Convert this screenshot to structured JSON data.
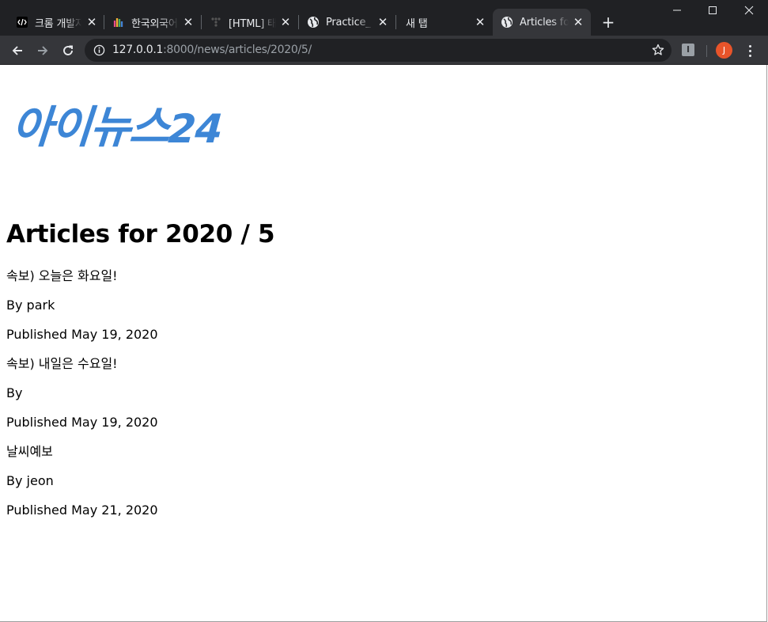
{
  "browser": {
    "tabs": [
      {
        "title": "크롬 개발자 도구",
        "favicon": "devtools-icon",
        "active": false
      },
      {
        "title": "한국외국어대학교",
        "favicon": "hufs-icon",
        "active": false
      },
      {
        "title": "[HTML] 태그",
        "favicon": "tistory-icon",
        "active": false
      },
      {
        "title": "Practice_",
        "favicon": "globe-icon",
        "active": false
      },
      {
        "title": "새 탭",
        "favicon": "",
        "active": false
      },
      {
        "title": "Articles for",
        "favicon": "globe-icon",
        "active": true
      }
    ],
    "new_tab_label": "+",
    "url_host": "127.0.0.1",
    "url_rest": ":8000/news/articles/2020/5/",
    "profile_initial": "J",
    "extension_label": "I",
    "colors": {
      "tabbar": "#202124",
      "toolbar": "#35363a",
      "avatar": "#e8542a"
    }
  },
  "page": {
    "logo": "아이뉴스",
    "logo_number": "24",
    "logo_color": "#3d86d6",
    "heading": "Articles for 2020 / 5",
    "articles": [
      {
        "headline": "속보) 오늘은 화요일!",
        "byline": "By park",
        "published": "Published May 19, 2020"
      },
      {
        "headline": "속보) 내일은 수요일!",
        "byline": "By",
        "published": "Published May 19, 2020"
      },
      {
        "headline": "날씨예보",
        "byline": "By jeon",
        "published": "Published May 21, 2020"
      }
    ]
  }
}
